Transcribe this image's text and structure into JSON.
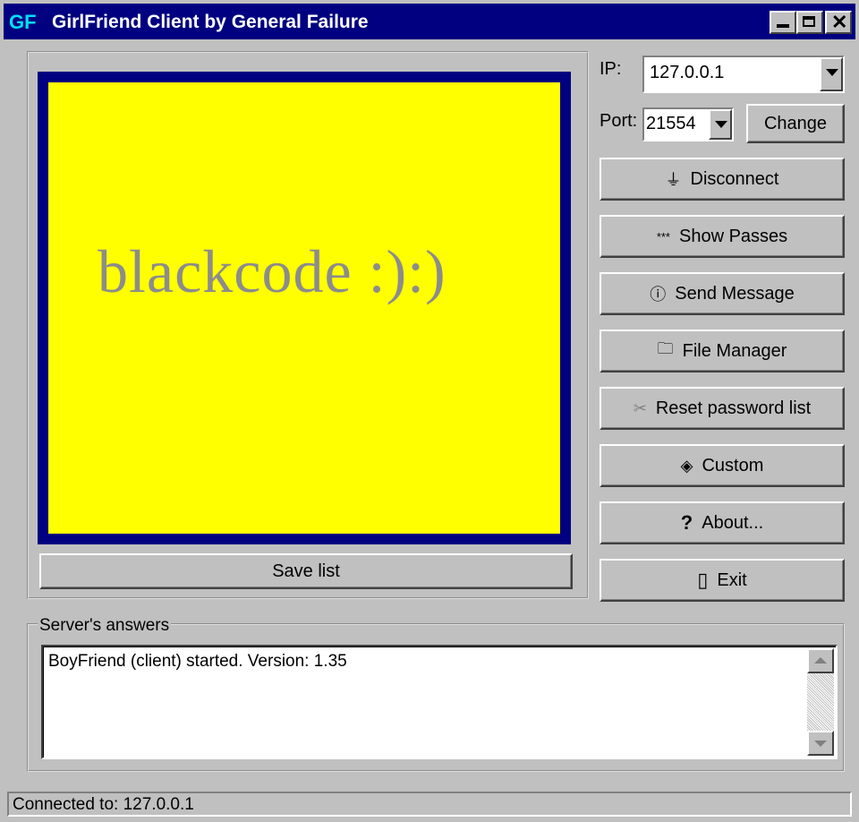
{
  "window": {
    "logo": "GF",
    "title": "GirlFriend Client by General Failure"
  },
  "display": {
    "text": "blackcode :):)",
    "background": "#ffff00",
    "border_color": "#000080"
  },
  "buttons": {
    "save_list": "Save list",
    "change": "Change",
    "disconnect": "Disconnect",
    "show_passes": "Show Passes",
    "send_message": "Send Message",
    "file_manager": "File Manager",
    "reset_password_list": "Reset password list",
    "custom": "Custom",
    "about": "About...",
    "exit": "Exit"
  },
  "connection": {
    "ip_label": "IP:",
    "ip_value": "127.0.0.1",
    "port_label": "Port:",
    "port_value": "21554"
  },
  "server_answers": {
    "label": "Server's answers",
    "lines": [
      "BoyFriend (client) started. Version: 1.35"
    ]
  },
  "status_bar": {
    "text": "Connected to: 127.0.0.1"
  }
}
